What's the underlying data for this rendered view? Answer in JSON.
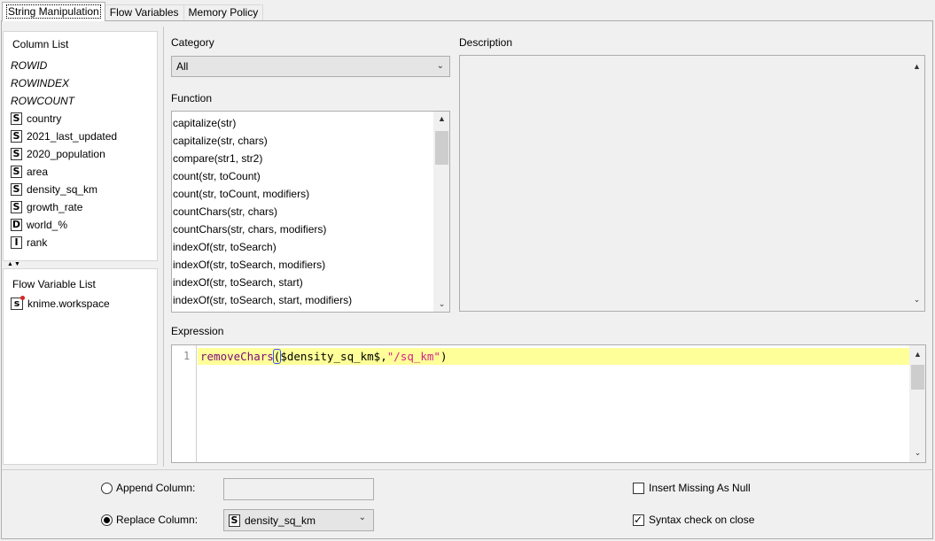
{
  "tabs": [
    {
      "label": "String Manipulation",
      "active": true
    },
    {
      "label": "Flow Variables",
      "active": false
    },
    {
      "label": "Memory Policy",
      "active": false
    }
  ],
  "column_list": {
    "title": "Column List",
    "special": [
      "ROWID",
      "ROWINDEX",
      "ROWCOUNT"
    ],
    "columns": [
      {
        "type": "S",
        "name": "country"
      },
      {
        "type": "S",
        "name": "2021_last_updated"
      },
      {
        "type": "S",
        "name": "2020_population"
      },
      {
        "type": "S",
        "name": "area"
      },
      {
        "type": "S",
        "name": "density_sq_km"
      },
      {
        "type": "S",
        "name": "growth_rate"
      },
      {
        "type": "D",
        "name": "world_%"
      },
      {
        "type": "I",
        "name": "rank"
      }
    ]
  },
  "flow_variable_list": {
    "title": "Flow Variable List",
    "items": [
      {
        "type": "s",
        "name": "knime.workspace"
      }
    ]
  },
  "category": {
    "label": "Category",
    "selected": "All"
  },
  "function": {
    "label": "Function",
    "items": [
      "capitalize(str)",
      "capitalize(str, chars)",
      "compare(str1, str2)",
      "count(str, toCount)",
      "count(str, toCount, modifiers)",
      "countChars(str, chars)",
      "countChars(str, chars, modifiers)",
      "indexOf(str, toSearch)",
      "indexOf(str, toSearch, modifiers)",
      "indexOf(str, toSearch, start)",
      "indexOf(str, toSearch, start, modifiers)"
    ]
  },
  "description": {
    "label": "Description"
  },
  "expression": {
    "label": "Expression",
    "line_number": "1",
    "code": {
      "fn": "removeChars",
      "open_paren": "(",
      "var": "$density_sq_km$",
      "comma": ",",
      "str": "\"/sq_km\"",
      "close_paren": ")"
    }
  },
  "bottom": {
    "append_label": "Append Column:",
    "append_selected": false,
    "append_value": "",
    "replace_label": "Replace Column:",
    "replace_selected": true,
    "replace_type": "S",
    "replace_value": "density_sq_km",
    "insert_missing_label": "Insert Missing As Null",
    "insert_missing_checked": false,
    "syntax_check_label": "Syntax check on close",
    "syntax_check_checked": true
  }
}
